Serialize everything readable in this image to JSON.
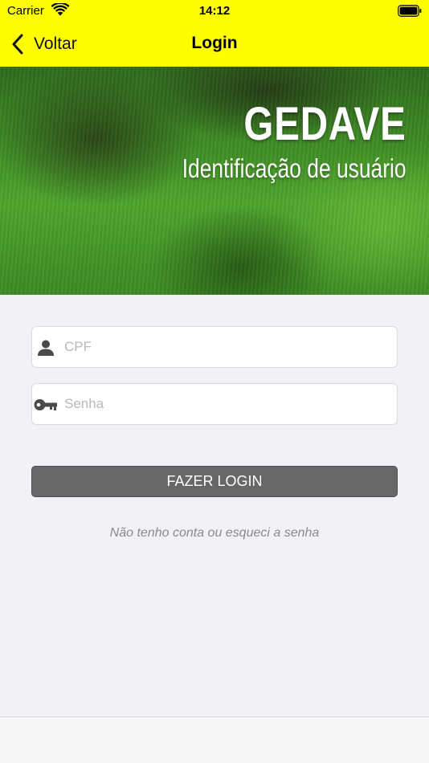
{
  "status_bar": {
    "carrier": "Carrier",
    "time": "14:12"
  },
  "nav": {
    "back_label": "Voltar",
    "title": "Login"
  },
  "hero": {
    "title": "GEDAVE",
    "subtitle": "Identificação de usuário"
  },
  "form": {
    "cpf_placeholder": "CPF",
    "senha_placeholder": "Senha",
    "login_button": "FAZER LOGIN",
    "help_link": "Não tenho conta ou esqueci a senha"
  },
  "colors": {
    "nav_background": "#ffff00",
    "button_background": "#676767",
    "page_background": "#f2f2f6"
  },
  "icons": {
    "wifi": "wifi-icon",
    "battery": "battery-icon",
    "back": "chevron-left-icon",
    "cpf": "user-icon",
    "senha": "key-icon"
  }
}
